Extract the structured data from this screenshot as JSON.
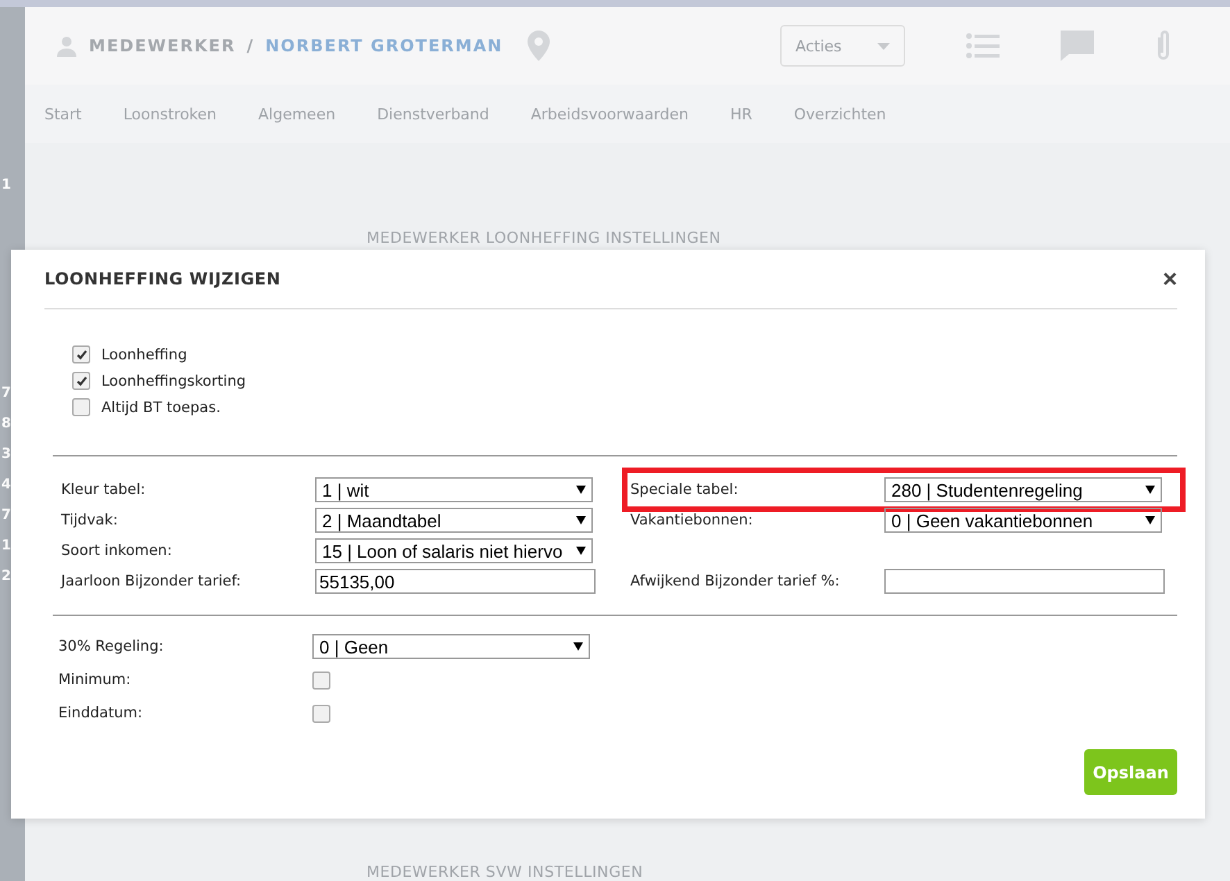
{
  "header": {
    "label": "MEDEWERKER",
    "separator": "/",
    "name": "NORBERT GROTERMAN",
    "actions": "Acties"
  },
  "nav": [
    {
      "label": "Start",
      "selected": false
    },
    {
      "label": "Loonstroken",
      "selected": false
    },
    {
      "label": "Algemeen",
      "selected": false
    },
    {
      "label": "Dienstverband",
      "selected": false
    },
    {
      "label": "Arbeidsvoorwaarden",
      "selected": false
    },
    {
      "label": "HR",
      "selected": false
    },
    {
      "label": "Overzichten",
      "selected": false
    }
  ],
  "sidebar_fragments": [
    "1",
    "7",
    "8",
    "3",
    "4",
    "7",
    "1",
    "2"
  ],
  "background_sections": [
    "MEDEWERKER LOONHEFFING INSTELLINGEN",
    "MEDEWERKER SVW INSTELLINGEN"
  ],
  "dialog": {
    "title": "LOONHEFFING WIJZIGEN",
    "close": "×",
    "checkboxes": [
      {
        "label": "Loonheffing",
        "checked": true
      },
      {
        "label": "Loonheffingskorting",
        "checked": true
      },
      {
        "label": "Altijd BT toepas.",
        "checked": false
      }
    ],
    "left_fields": [
      {
        "kind": "select",
        "label": "Kleur tabel:",
        "value": "1 | wit"
      },
      {
        "kind": "select",
        "label": "Tijdvak:",
        "value": "2 | Maandtabel"
      },
      {
        "kind": "select",
        "label": "Soort inkomen:",
        "value": "15 | Loon of salaris niet hiervo"
      },
      {
        "kind": "input",
        "label": "Jaarloon Bijzonder tarief:",
        "value": "55135,00"
      }
    ],
    "right_fields": [
      {
        "kind": "select",
        "label": "Speciale tabel:",
        "value": "280 | Studentenregeling",
        "highlighted": true
      },
      {
        "kind": "select",
        "label": "Vakantiebonnen:",
        "value": "0 | Geen vakantiebonnen",
        "highlighted": false
      },
      {
        "kind": "spacer"
      },
      {
        "kind": "input",
        "label": "Afwijkend Bijzonder tarief %:"
      }
    ],
    "extra_fields": [
      {
        "kind": "select",
        "label": "30% Regeling:",
        "value": "0 | Geen"
      },
      {
        "kind": "checkbox",
        "label": "Minimum:",
        "checked": false
      },
      {
        "kind": "checkbox",
        "label": "Einddatum:",
        "checked": false
      }
    ],
    "save": "Opslaan"
  }
}
